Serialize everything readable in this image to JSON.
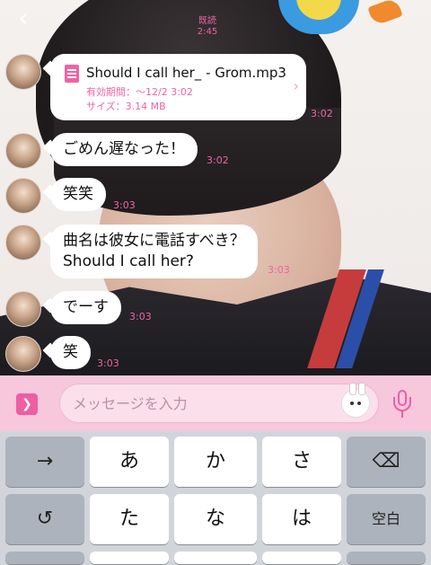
{
  "header": {
    "back_icon": "chevron-left-icon",
    "read_label": "既読",
    "read_time": "2:45"
  },
  "messages": [
    {
      "type": "file",
      "file_name": "Should I call her_ - Grom.mp3",
      "expiry": "有効期間：〜12/2 3:02",
      "size": "サイズ：3.14 MB",
      "time": "3:02"
    },
    {
      "type": "text",
      "text": "ごめん遅なった！",
      "time": "3:02"
    },
    {
      "type": "text",
      "text": "笑笑",
      "time": "3:03"
    },
    {
      "type": "text",
      "text_line1": "曲名は彼女に電話すべき？",
      "text_line2": "Should I call her?",
      "time": "3:03"
    },
    {
      "type": "text",
      "text": "でーす",
      "time": "3:03"
    },
    {
      "type": "text",
      "text": "笑",
      "time": "3:03"
    }
  ],
  "input_bar": {
    "placeholder": "メッセージを入力",
    "expand_icon": "chevron-right-icon",
    "sticker_icon": "sticker-icon",
    "mic_icon": "microphone-icon"
  },
  "keyboard": {
    "row1": [
      "→",
      "あ",
      "か",
      "さ",
      "⌫"
    ],
    "row2": [
      "↺",
      "た",
      "な",
      "は",
      "空白"
    ],
    "colors": {
      "key": "#ffffff",
      "func_key": "#adb3bc",
      "background": "#d1d5db"
    }
  },
  "colors": {
    "accent_pink": "#f062a6",
    "input_bar": "#f7c7dc",
    "bubble": "#ffffff"
  }
}
